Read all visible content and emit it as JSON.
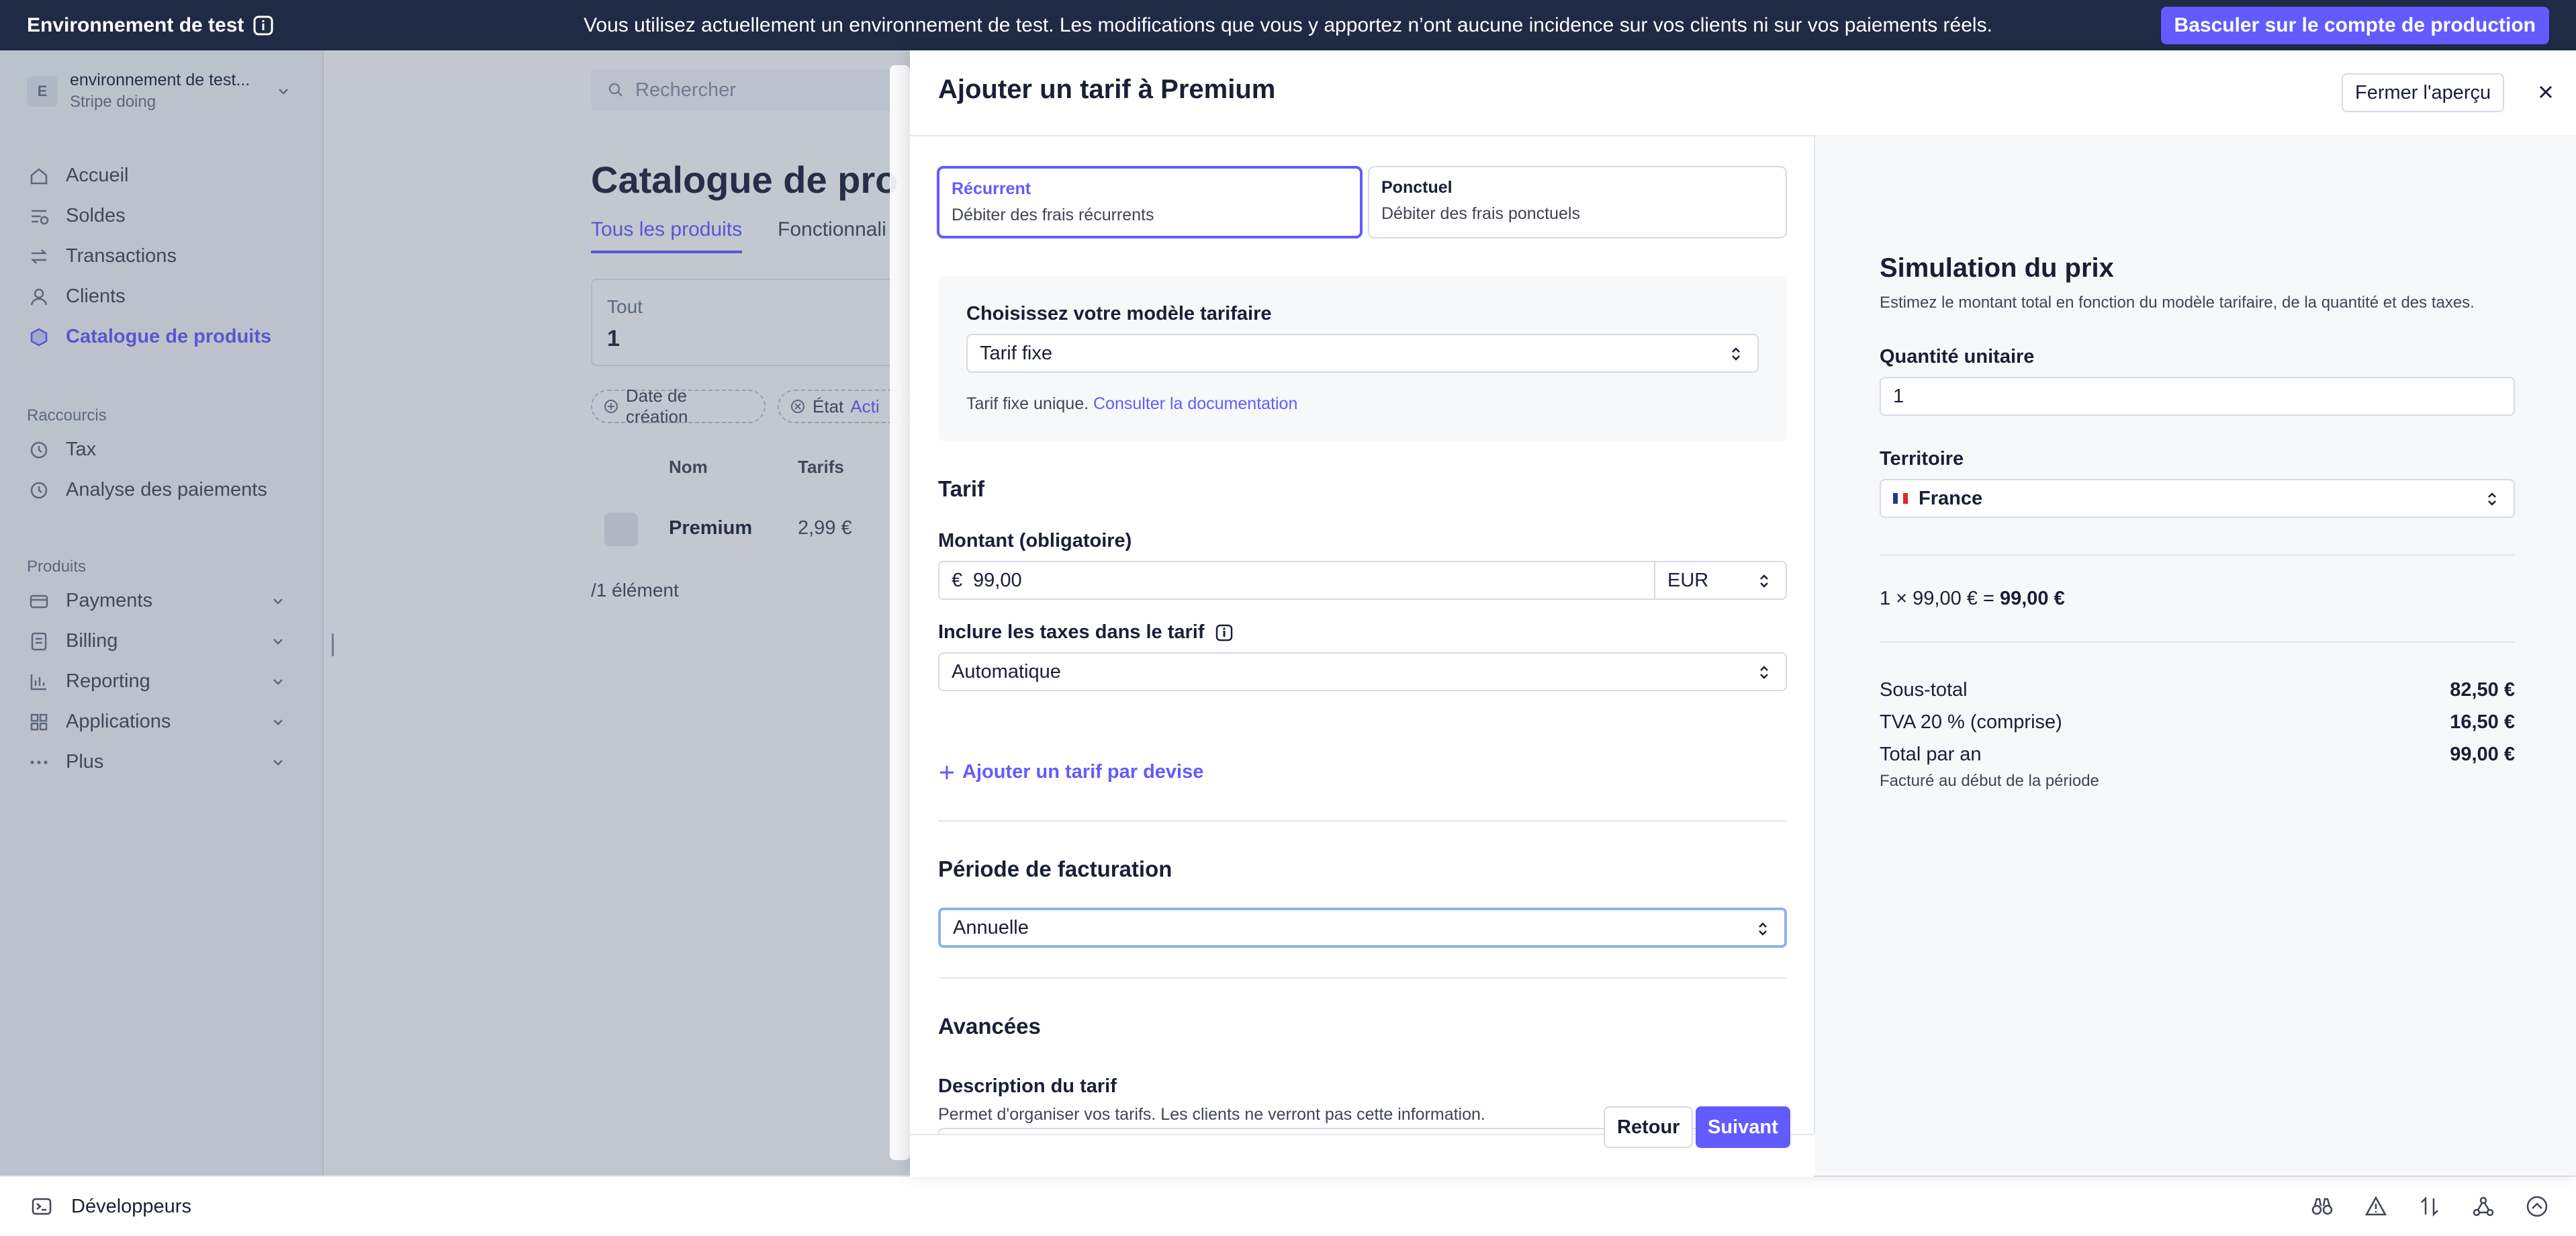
{
  "banner": {
    "env_label": "Environnement de test",
    "message": "Vous utilisez actuellement un environnement de test. Les modifications que vous y apportez n’ont aucune incidence sur vos clients ni sur vos paiements réels.",
    "production_button": "Basculer sur le compte de production"
  },
  "sidebar": {
    "account_initial": "E",
    "account_name": "environnement de test...",
    "account_sub": "Stripe doing",
    "items": [
      {
        "label": "Accueil",
        "icon": "home-icon"
      },
      {
        "label": "Soldes",
        "icon": "balance-icon"
      },
      {
        "label": "Transactions",
        "icon": "transfer-icon"
      },
      {
        "label": "Clients",
        "icon": "user-icon"
      },
      {
        "label": "Catalogue de produits",
        "icon": "box-icon"
      }
    ],
    "shortcuts_title": "Raccourcis",
    "shortcuts": [
      {
        "label": "Tax",
        "icon": "clock-icon"
      },
      {
        "label": "Analyse des paiements",
        "icon": "clock-icon"
      }
    ],
    "products_title": "Produits",
    "products": [
      {
        "label": "Payments",
        "icon": "card-icon"
      },
      {
        "label": "Billing",
        "icon": "invoice-icon"
      },
      {
        "label": "Reporting",
        "icon": "chart-icon"
      },
      {
        "label": "Applications",
        "icon": "apps-icon"
      },
      {
        "label": "Plus",
        "icon": "more-icon"
      }
    ]
  },
  "catalog": {
    "search_placeholder": "Rechercher",
    "title": "Catalogue de pro",
    "tab_all": "Tous les produits",
    "tab_features": "Fonctionnali",
    "card_all_label": "Tout",
    "card_all_value": "1",
    "filter_created": "Date de création",
    "filter_state": "État",
    "filter_state_value": "Acti",
    "col_name": "Nom",
    "col_prices": "Tarifs",
    "row_name": "Premium",
    "row_price": "2,99 €",
    "count": "/1 élément"
  },
  "devbar": {
    "label": "Développeurs"
  },
  "drawer": {
    "title": "Ajouter un tarif à Premium",
    "close_preview": "Fermer l'aperçu",
    "recurring_title": "Récurrent",
    "recurring_desc": "Débiter des frais récurrents",
    "oneoff_title": "Ponctuel",
    "oneoff_desc": "Débiter des frais ponctuels",
    "model_label": "Choisissez votre modèle tarifaire",
    "model_value": "Tarif fixe",
    "model_help": "Tarif fixe unique.",
    "model_doc_link": "Consulter la documentation",
    "tarif_heading": "Tarif",
    "amount_label": "Montant (obligatoire)",
    "currency_symbol": "€",
    "amount_value": "99,00",
    "currency_value": "EUR",
    "tax_label": "Inclure les taxes dans le tarif",
    "tax_value": "Automatique",
    "add_currency": "Ajouter un tarif par devise",
    "period_heading": "Période de facturation",
    "period_value": "Annuelle",
    "advanced_heading": "Avancées",
    "desc_label": "Description du tarif",
    "desc_help": "Permet d'organiser vos tarifs. Les clients ne verront pas cette information.",
    "back_button": "Retour",
    "next_button": "Suivant"
  },
  "preview": {
    "title": "Simulation du prix",
    "subtitle": "Estimez le montant total en fonction du modèle tarifaire, de la quantité et des taxes.",
    "qty_label": "Quantité unitaire",
    "qty_value": "1",
    "territory_label": "Territoire",
    "territory_value": "France",
    "calc_prefix": "1 × 99,00 € = ",
    "calc_total": "99,00 €",
    "subtotal_label": "Sous-total",
    "subtotal_value": "82,50 €",
    "vat_label": "TVA 20 % (comprise)",
    "vat_value": "16,50 €",
    "total_label": "Total par an",
    "total_value": "99,00 €",
    "billed_note": "Facturé au début de la période"
  },
  "colors": {
    "accent": "#635bff",
    "banner_bg": "#1f2a44",
    "text": "#1a1f36",
    "muted": "#697386"
  }
}
